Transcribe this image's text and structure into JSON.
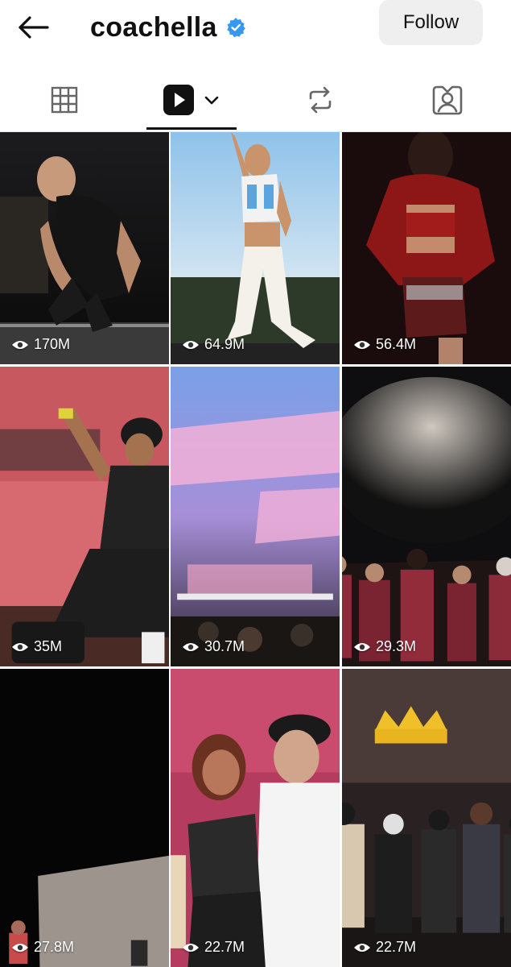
{
  "header": {
    "title": "coachella",
    "follow_label": "Follow",
    "verified_color": "#3897f0"
  },
  "tabs": [
    {
      "name": "grid",
      "icon": "grid-icon",
      "selected": false
    },
    {
      "name": "reels",
      "icon": "reels-icon",
      "selected": true
    },
    {
      "name": "reposts",
      "icon": "repost-icon",
      "selected": false
    },
    {
      "name": "tagged",
      "icon": "tagged-person-icon",
      "selected": false
    }
  ],
  "reels": [
    {
      "views": "170M"
    },
    {
      "views": "64.9M"
    },
    {
      "views": "56.4M"
    },
    {
      "views": "35M"
    },
    {
      "views": "30.7M"
    },
    {
      "views": "29.3M"
    },
    {
      "views": "27.8M"
    },
    {
      "views": "22.7M"
    },
    {
      "views": "22.7M"
    }
  ]
}
